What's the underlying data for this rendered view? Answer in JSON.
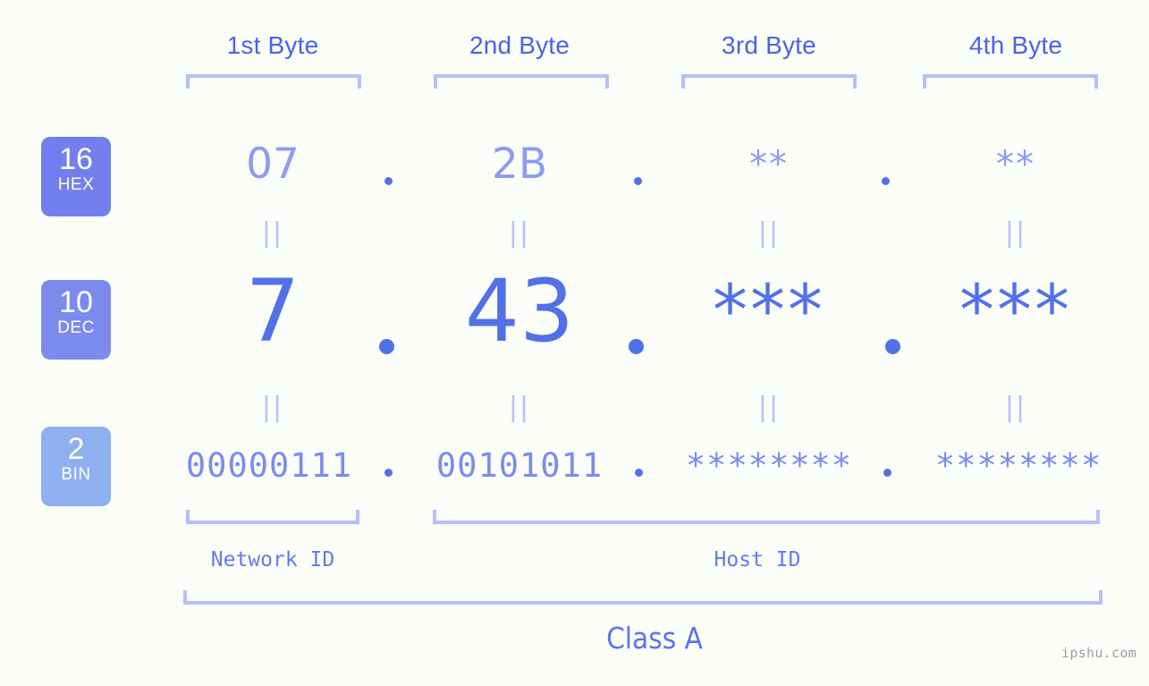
{
  "background_color": "#fbfdf9",
  "accent_color": "#5271e8",
  "bracket_color": "#b6c0f8",
  "header": {
    "bytes": [
      {
        "label": "1st Byte"
      },
      {
        "label": "2nd Byte"
      },
      {
        "label": "3rd Byte"
      },
      {
        "label": "4th Byte"
      }
    ]
  },
  "bases": [
    {
      "num": "16",
      "abbr": "HEX",
      "color": "#737fee"
    },
    {
      "num": "10",
      "abbr": "DEC",
      "color": "#7c8aee"
    },
    {
      "num": "2",
      "abbr": "BIN",
      "color": "#8eb0f0"
    }
  ],
  "rows": {
    "hex": {
      "values": [
        "07",
        "2B",
        "**",
        "**"
      ]
    },
    "dec": {
      "values": [
        "7",
        "43",
        "***",
        "***"
      ]
    },
    "bin": {
      "values": [
        "00000111",
        "00101011",
        "********",
        "********"
      ]
    }
  },
  "separator": ".",
  "equals_mark": "||",
  "sections": {
    "network_id": "Network ID",
    "host_id": "Host ID",
    "class": "Class A"
  },
  "watermark": "ipshu.com"
}
